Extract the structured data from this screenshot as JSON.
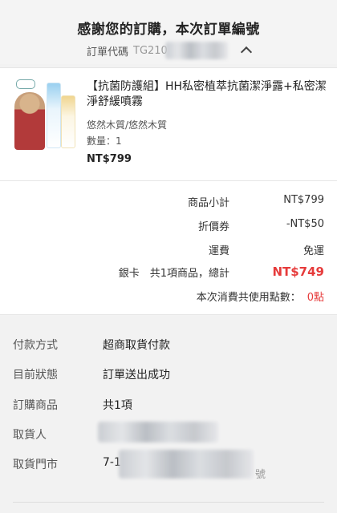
{
  "header": {
    "title": "感謝您的訂購，本次訂單編號",
    "order_code_label": "訂單代碼",
    "order_code_visible": "TG210"
  },
  "product": {
    "name": "【抗菌防護組】HH私密植萃抗菌潔淨露+私密潔淨舒緩噴霧",
    "brand": "悠然木質/悠然木質",
    "qty_label": "數量：",
    "qty": "1",
    "price": "NT$799"
  },
  "summary": {
    "subtotal_label": "商品小計",
    "subtotal": "NT$799",
    "coupon_label": "折價券",
    "coupon": "-NT$50",
    "shipping_label": "運費",
    "shipping": "免運",
    "total_label": "銀卡　共1項商品，總計",
    "total": "NT$749",
    "points_label": "本次消費共使用點數：",
    "points": "0點"
  },
  "info": {
    "payment_label": "付款方式",
    "payment": "超商取貨付款",
    "status_label": "目前狀態",
    "status": "訂單送出成功",
    "items_label": "訂購商品",
    "items": "共1項",
    "recipient_label": "取貨人",
    "store_label": "取貨門市",
    "store_prefix": "7-1",
    "store_suffix": "號"
  },
  "colors": {
    "accent_red": "#e63b3b",
    "background": "#f2f2f2"
  },
  "icons": {
    "toggle": "chevron-up-icon"
  }
}
